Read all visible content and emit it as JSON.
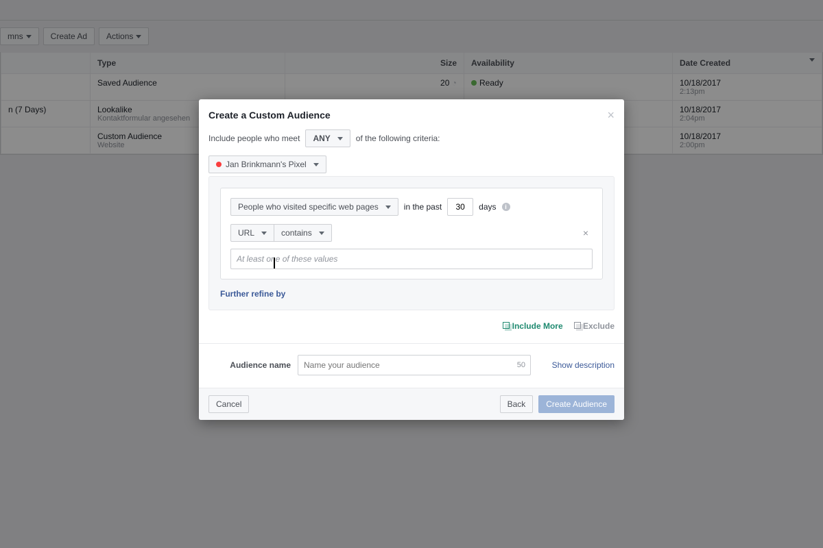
{
  "toolbar": {
    "columns": "mns",
    "create_ad": "Create Ad",
    "actions": "Actions"
  },
  "table": {
    "headers": {
      "name": "",
      "type": "Type",
      "size": "Size",
      "availability": "Availability",
      "date_created": "Date Created"
    },
    "rows": [
      {
        "name": "",
        "type": "Saved Audience",
        "subtype": "",
        "size": "20",
        "availability": "Ready",
        "date": "10/18/2017",
        "time": "2:13pm"
      },
      {
        "name": "n (7 Days)",
        "type": "Lookalike",
        "subtype": "Kontaktformular angesehen",
        "size": "",
        "availability": "",
        "date": "10/18/2017",
        "time": "2:04pm"
      },
      {
        "name": "",
        "type": "Custom Audience",
        "subtype": "Website",
        "size": "",
        "availability": "",
        "date": "10/18/2017",
        "time": "2:00pm"
      }
    ]
  },
  "modal": {
    "title": "Create a Custom Audience",
    "include_prefix": "Include people who meet",
    "any": "ANY",
    "include_suffix": "of the following criteria:",
    "pixel": "Jan Brinkmann's Pixel",
    "visit_rule": "People who visited specific web pages",
    "in_past": "in the past",
    "days_value": "30",
    "days_label": "days",
    "url_label": "URL",
    "contains_label": "contains",
    "values_placeholder": "At least one of these values",
    "refine": "Further refine by",
    "include_more": "Include More",
    "exclude": "Exclude",
    "audience_name_label": "Audience name",
    "audience_name_placeholder": "Name your audience",
    "name_counter": "50",
    "show_description": "Show description",
    "cancel": "Cancel",
    "back": "Back",
    "create_audience": "Create Audience"
  }
}
